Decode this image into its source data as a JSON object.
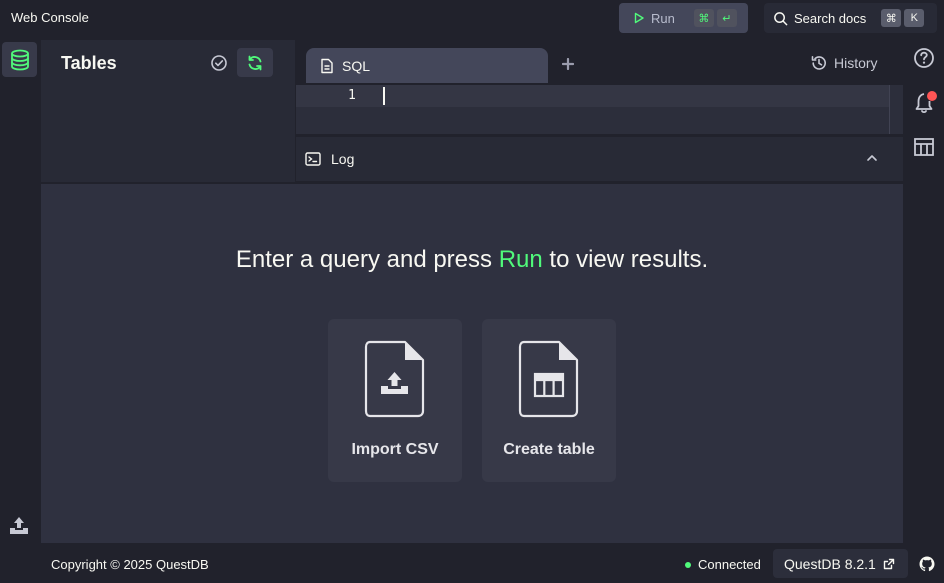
{
  "header": {
    "title": "Web Console",
    "run_label": "Run",
    "run_shortcut": [
      "⌘",
      "↵"
    ],
    "search_label": "Search docs",
    "search_shortcut": [
      "⌘",
      "K"
    ]
  },
  "tables_panel": {
    "title": "Tables"
  },
  "editor": {
    "tab_label": "SQL",
    "history_label": "History",
    "line_number": "1",
    "log_label": "Log"
  },
  "results": {
    "prompt_before": "Enter a query and press ",
    "prompt_run": "Run",
    "prompt_after": " to view results.",
    "cards": [
      {
        "label": "Import CSV",
        "icon": "file-upload-icon"
      },
      {
        "label": "Create table",
        "icon": "file-table-icon"
      }
    ]
  },
  "footer": {
    "copyright": "Copyright © 2025 QuestDB",
    "status": "Connected",
    "version": "QuestDB 8.2.1"
  },
  "colors": {
    "accent": "#50fa7b",
    "background": "#21222c",
    "panel": "#282a36",
    "results_bg": "#2f3140",
    "notification": "#ff5555"
  }
}
